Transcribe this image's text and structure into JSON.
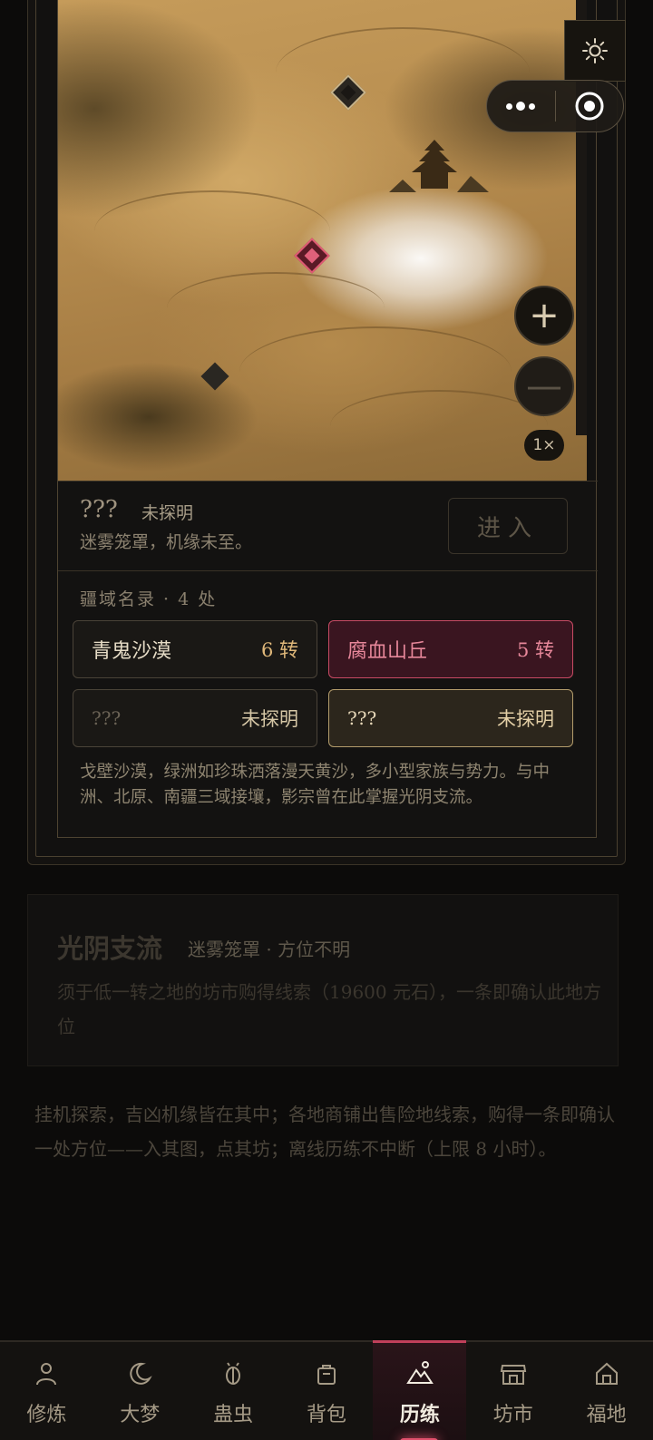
{
  "map": {
    "zoom_in_label": "+",
    "zoom_out_label": "—",
    "zoom_level": "1×"
  },
  "capsule": {
    "more_icon": "more-dots-icon",
    "close_icon": "target-circle-icon",
    "theme_icon": "sun-icon"
  },
  "location": {
    "name": "???",
    "status": "未探明",
    "description": "迷雾笼罩，机缘未至。",
    "enter_label": "进入"
  },
  "regions": {
    "title": "疆域名录 · 4 处",
    "items": [
      {
        "name": "青鬼沙漠",
        "tag": "6 转",
        "state": "known"
      },
      {
        "name": "腐血山丘",
        "tag": "5 转",
        "state": "current"
      },
      {
        "name": "???",
        "tag": "未探明",
        "state": "unknown"
      },
      {
        "name": "???",
        "tag": "未探明",
        "state": "selected"
      }
    ],
    "description": "戈壁沙漠，绿洲如珍珠洒落漫天黄沙，多小型家族与势力。与中洲、北原、南疆三域接壤，影宗曾在此掌握光阴支流。"
  },
  "stream": {
    "title": "光阴支流",
    "subtitle": "迷雾笼罩 · 方位不明",
    "description": "须于低一转之地的坊市购得线索（19600 元石），一条即确认此地方位"
  },
  "footnote": "挂机探索，吉凶机缘皆在其中；各地商铺出售险地线索，购得一条即确认一处方位——入其图，点其坊；离线历练不中断（上限 8 小时）。",
  "tabs": [
    {
      "label": "修炼",
      "icon": "person-icon",
      "active": false
    },
    {
      "label": "大梦",
      "icon": "moon-icon",
      "active": false
    },
    {
      "label": "蛊虫",
      "icon": "bug-icon",
      "active": false
    },
    {
      "label": "背包",
      "icon": "bag-icon",
      "active": false
    },
    {
      "label": "历练",
      "icon": "mountain-icon",
      "active": true
    },
    {
      "label": "坊市",
      "icon": "shop-icon",
      "active": false
    },
    {
      "label": "福地",
      "icon": "home-icon",
      "active": false
    }
  ],
  "colors": {
    "accent": "#c0405a",
    "gold": "#e0b87a",
    "background": "#0c0b0a"
  }
}
